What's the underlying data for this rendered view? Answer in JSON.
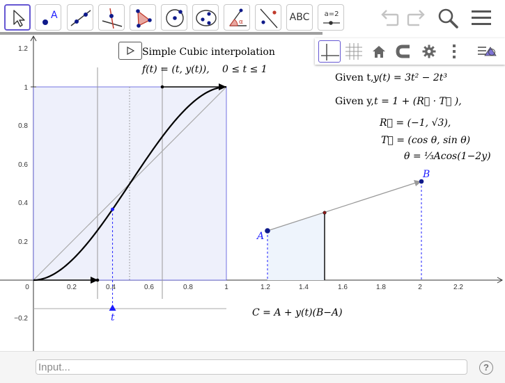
{
  "toolbar": {
    "tools": [
      {
        "name": "move-tool",
        "icon": "cursor-arrow-icon"
      },
      {
        "name": "point-tool",
        "icon": "point-icon",
        "label": "A"
      },
      {
        "name": "line-tool",
        "icon": "line-through-points-icon"
      },
      {
        "name": "perpendicular-tool",
        "icon": "perpendicular-line-icon"
      },
      {
        "name": "polygon-tool",
        "icon": "polygon-icon"
      },
      {
        "name": "circle-tool",
        "icon": "circle-center-point-icon"
      },
      {
        "name": "conic-tool",
        "icon": "ellipse-icon"
      },
      {
        "name": "angle-tool",
        "icon": "angle-icon",
        "label": "α"
      },
      {
        "name": "reflect-tool",
        "icon": "reflect-about-line-icon"
      },
      {
        "name": "text-tool",
        "icon": "text-icon",
        "label": "ABC"
      },
      {
        "name": "slider-tool",
        "icon": "slider-icon",
        "label": "a=2"
      }
    ],
    "right_icons": [
      "undo-icon",
      "redo-icon",
      "search-icon",
      "menu-icon"
    ]
  },
  "graphics_bar": {
    "icons": [
      "axes-icon",
      "grid-icon",
      "home-icon",
      "magnet-icon",
      "gear-icon",
      "more-vertical-icon",
      "style-bar-toggle-icon"
    ]
  },
  "graph": {
    "title": "Simple Cubic interpolation",
    "fn_lhs": "f(t) = (t, y(t)),",
    "fn_rhs": "0 ≤ t ≤ 1",
    "given_t_prefix": "Given t,",
    "given_t_eq": "y(t) = 3t² − 2t³",
    "given_y_prefix": "Given y,",
    "given_y_eq": "t = 1 + (R⃗ · T⃗ ),",
    "r_vec": "R⃗ = (−1, √3),",
    "t_vec": "T⃗ = (cos θ, sin θ)",
    "theta_eq": "θ = ⅓Acos(1−2y)",
    "c_eq": "C = A + y(t)(B−A)",
    "point_a": "A",
    "point_b": "B",
    "slider_label": "t",
    "y_ticks": [
      "1.2",
      "1",
      "0.8",
      "0.6",
      "0.4",
      "0.2",
      "−0.2"
    ],
    "x_ticks": [
      "0",
      "0.2",
      "0.4",
      "0.6",
      "0.8",
      "1",
      "1.2",
      "1.4",
      "1.6",
      "1.8",
      "2",
      "2.2"
    ],
    "t_value": 0.41,
    "colors": {
      "accent": "#1c1cff",
      "curve": "#000000",
      "region": "#eef0fb",
      "toolbar_select": "#6557d2"
    }
  },
  "input_bar": {
    "placeholder": "Input...",
    "help": "?"
  }
}
